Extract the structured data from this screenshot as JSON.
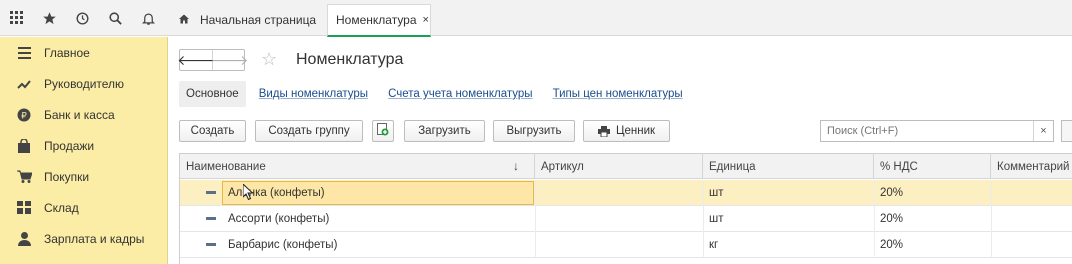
{
  "top_icons": [
    "apps-grid-icon",
    "star-icon",
    "history-icon",
    "search-icon",
    "bell-icon"
  ],
  "tabs": {
    "home_label": "Начальная страница",
    "active_label": "Номенклатура",
    "close_glyph": "×"
  },
  "sidebar": {
    "items": [
      {
        "label": "Главное",
        "icon": "menu-icon"
      },
      {
        "label": "Руководителю",
        "icon": "trend-icon"
      },
      {
        "label": "Банк и касса",
        "icon": "coin-icon"
      },
      {
        "label": "Продажи",
        "icon": "bag-icon"
      },
      {
        "label": "Покупки",
        "icon": "cart-icon"
      },
      {
        "label": "Склад",
        "icon": "warehouse-icon"
      },
      {
        "label": "Зарплата и кадры",
        "icon": "person-icon"
      }
    ]
  },
  "page": {
    "title": "Номенклатура"
  },
  "sections": {
    "current": "Основное",
    "links": [
      "Виды номенклатуры",
      "Счета учета номенклатуры",
      "Типы цен номенклатуры"
    ]
  },
  "toolbar": {
    "create": "Создать",
    "create_group": "Создать группу",
    "load": "Загрузить",
    "unload": "Выгрузить",
    "price_tag": "Ценник"
  },
  "search": {
    "placeholder": "Поиск (Ctrl+F)",
    "clear_glyph": "×"
  },
  "table": {
    "columns": [
      "Наименование",
      "Артикул",
      "Единица",
      "% НДС",
      "Комментарий"
    ],
    "sort_glyph": "↓",
    "rows": [
      {
        "name": "Аленка (конфеты)",
        "article": "",
        "unit": "шт",
        "vat": "20%",
        "comment": "",
        "selected": true
      },
      {
        "name": "Ассорти (конфеты)",
        "article": "",
        "unit": "шт",
        "vat": "20%",
        "comment": "",
        "selected": false
      },
      {
        "name": "Барбарис (конфеты)",
        "article": "",
        "unit": "кг",
        "vat": "20%",
        "comment": "",
        "selected": false
      }
    ]
  },
  "colors": {
    "sidebar_bg": "#fbeda5",
    "active_tab_underline": "#1aa053",
    "link": "#1a4d8c",
    "selected_row": "#fcefc2"
  }
}
